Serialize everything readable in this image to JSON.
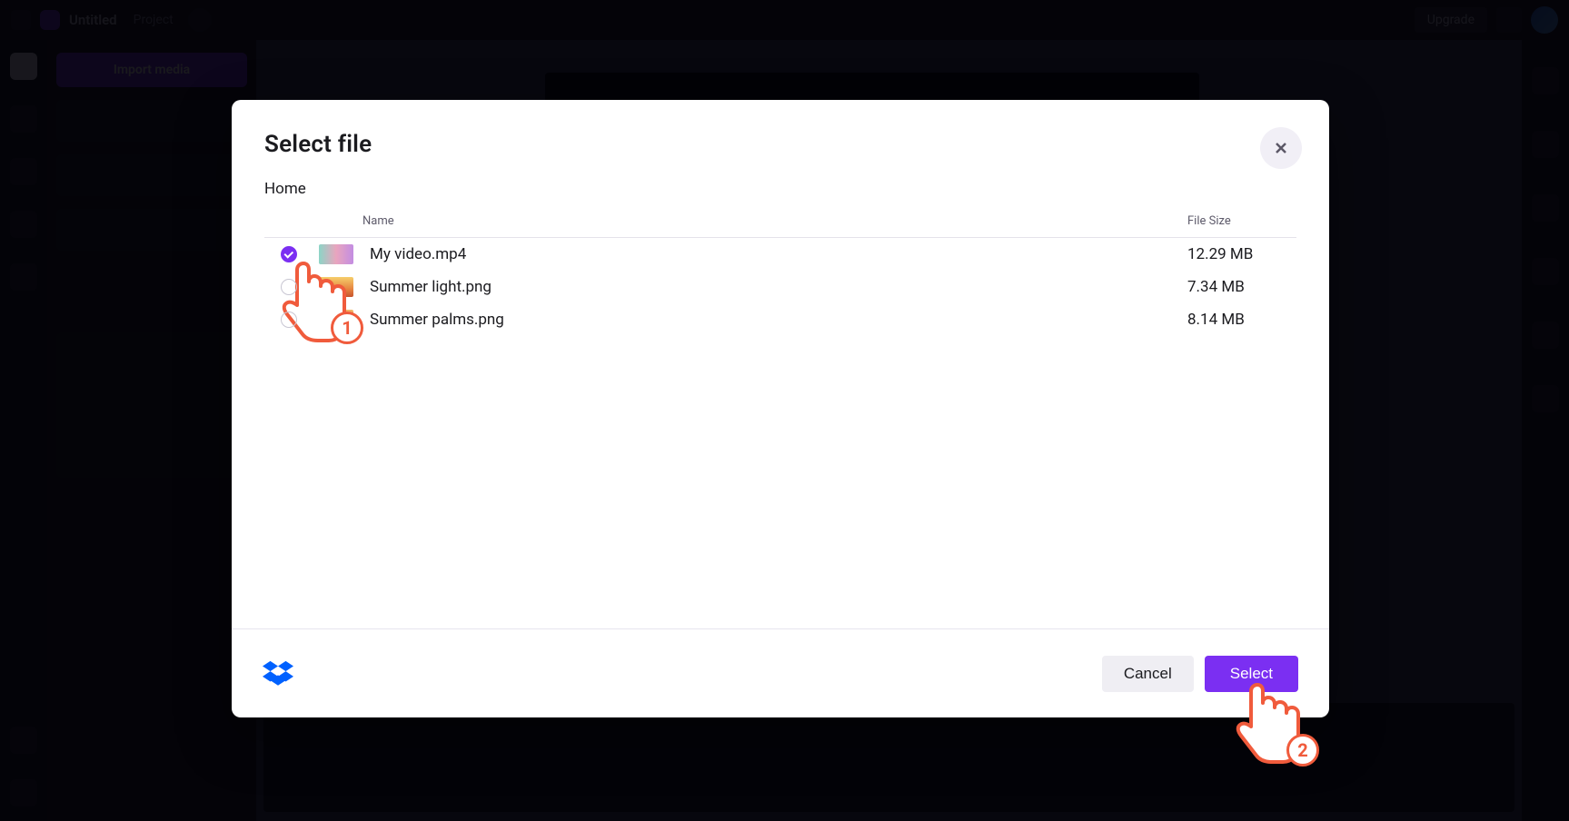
{
  "background": {
    "app_title": "Untitled",
    "project_label": "Project",
    "import_label": "Import media",
    "upgrade_label": "Upgrade"
  },
  "modal": {
    "title": "Select file",
    "breadcrumb": "Home",
    "columns": {
      "name": "Name",
      "size": "File Size"
    },
    "close_label": "Close",
    "files": [
      {
        "name": "My video.mp4",
        "size": "12.29 MB",
        "selected": true,
        "thumb": "vid"
      },
      {
        "name": "Summer light.png",
        "size": "7.34 MB",
        "selected": false,
        "thumb": "sun"
      },
      {
        "name": "Summer palms.png",
        "size": "8.14 MB",
        "selected": false,
        "thumb": "palms"
      }
    ],
    "provider": "dropbox",
    "actions": {
      "cancel": "Cancel",
      "select": "Select"
    }
  },
  "annotations": {
    "step1": "1",
    "step2": "2"
  }
}
